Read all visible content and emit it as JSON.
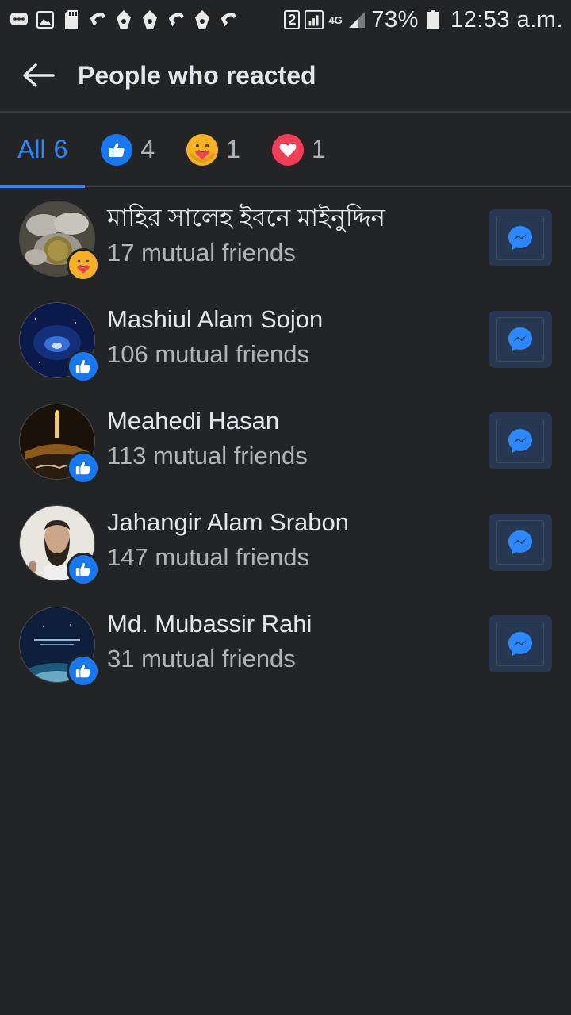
{
  "status_bar": {
    "signal_label": "4G",
    "battery": "73%",
    "time": "12:53 a.m.",
    "sim_number": "2"
  },
  "header": {
    "title": "People who reacted",
    "back_icon": "arrow-left-icon"
  },
  "tabs": [
    {
      "label": "All",
      "count": "6",
      "active": true
    },
    {
      "icon": "like-reaction-icon",
      "count": "4"
    },
    {
      "icon": "care-reaction-icon",
      "count": "1"
    },
    {
      "icon": "love-reaction-icon",
      "count": "1"
    }
  ],
  "people": [
    {
      "name": "মাহির সালেহ ইবনে মাইনুদ্দিন",
      "mutual": "17 mutual friends",
      "reaction": "care-reaction-icon"
    },
    {
      "name": "Mashiul Alam Sojon",
      "mutual": "106 mutual friends",
      "reaction": "like-reaction-icon"
    },
    {
      "name": "Meahedi Hasan",
      "mutual": "113 mutual friends",
      "reaction": "like-reaction-icon"
    },
    {
      "name": "Jahangir Alam Srabon",
      "mutual": "147 mutual friends",
      "reaction": "like-reaction-icon"
    },
    {
      "name": "Md. Mubassir Rahi",
      "mutual": "31 mutual friends",
      "reaction": "like-reaction-icon"
    }
  ],
  "colors": {
    "background": "#232425",
    "accent": "#2d88ff",
    "like": "#1877f2",
    "love": "#f33e58",
    "care": "#f7b125",
    "messenger_button": "#263951"
  }
}
